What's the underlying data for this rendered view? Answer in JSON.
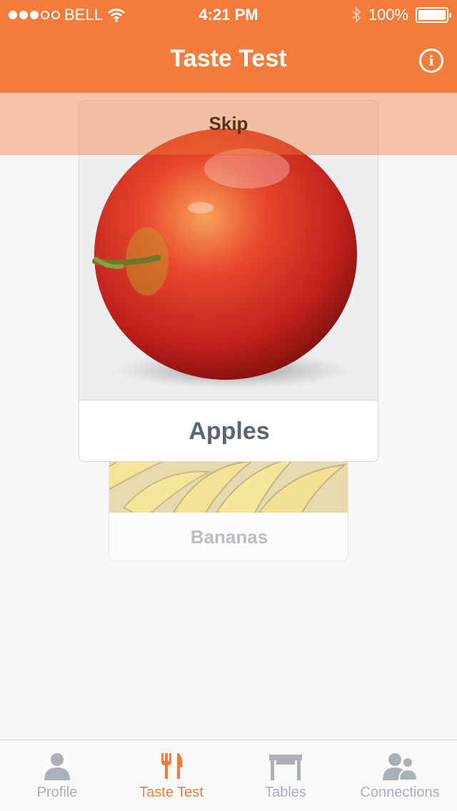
{
  "status_bar": {
    "carrier": "BELL",
    "time": "4:21 PM",
    "battery": "100%",
    "signal_bars": 3,
    "signal_total": 5,
    "icons": [
      "wifi-icon",
      "bluetooth-icon",
      "battery-icon"
    ]
  },
  "header": {
    "title": "Taste Test",
    "info_icon": "info-icon",
    "color": "#f37c3a"
  },
  "skip": {
    "label": "Skip"
  },
  "cards": [
    {
      "label": "Apples",
      "image": "apple-photo"
    },
    {
      "label": "Bananas",
      "image": "bananas-photo"
    }
  ],
  "tabbar": {
    "tabs": [
      {
        "label": "Profile",
        "icon": "profile-icon",
        "active": false
      },
      {
        "label": "Taste Test",
        "icon": "fork-knife-icon",
        "active": true
      },
      {
        "label": "Tables",
        "icon": "table-icon",
        "active": false
      },
      {
        "label": "Connections",
        "icon": "connections-icon",
        "active": false
      }
    ],
    "active_color": "#f37c3a",
    "inactive_color": "#aab0b8"
  }
}
